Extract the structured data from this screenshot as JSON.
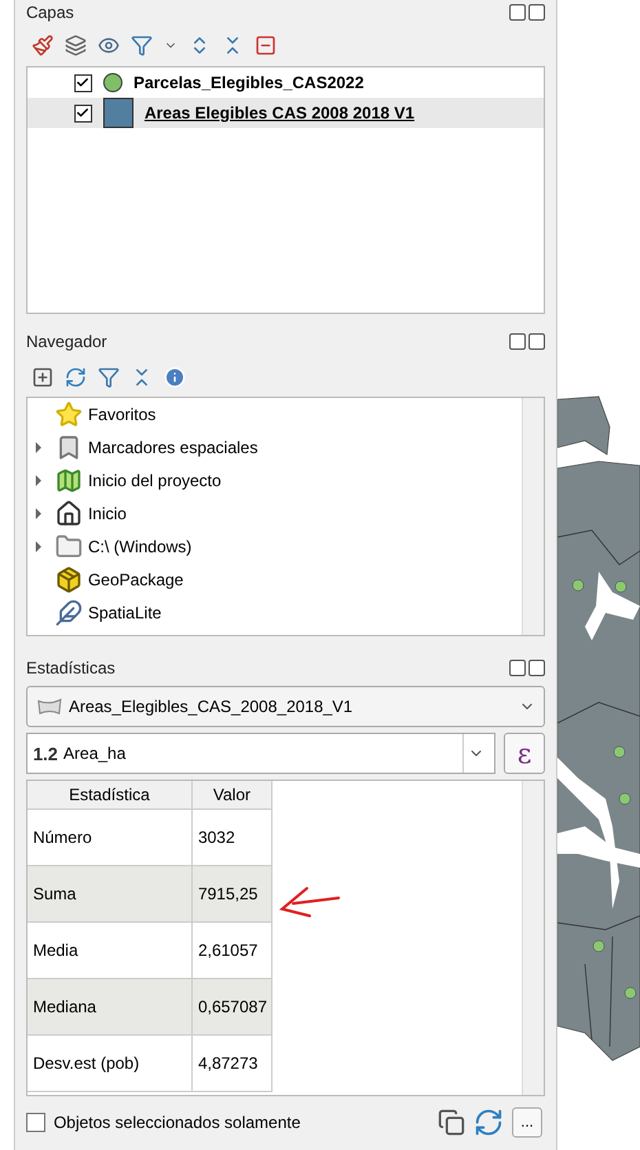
{
  "layers_panel": {
    "title": "Capas",
    "layers": [
      {
        "name": "Parcelas_Elegibles_CAS2022",
        "checked": true,
        "kind": "point",
        "color": "#7fbf67",
        "selected": false
      },
      {
        "name": "Areas Elegibles CAS 2008 2018 V1",
        "checked": true,
        "kind": "polygon",
        "color": "#527ea0",
        "selected": true
      }
    ]
  },
  "browser_panel": {
    "title": "Navegador",
    "items": [
      {
        "label": "Favoritos",
        "kind": "star",
        "expandable": false
      },
      {
        "label": "Marcadores espaciales",
        "kind": "bookmark",
        "expandable": true
      },
      {
        "label": "Inicio del proyecto",
        "kind": "project",
        "expandable": true
      },
      {
        "label": "Inicio",
        "kind": "home",
        "expandable": true
      },
      {
        "label": "C:\\ (Windows)",
        "kind": "folder",
        "expandable": true
      },
      {
        "label": "GeoPackage",
        "kind": "geopackage",
        "expandable": false
      },
      {
        "label": "SpatiaLite",
        "kind": "feather",
        "expandable": false
      }
    ]
  },
  "stats_panel": {
    "title": "Estadísticas",
    "layer": "Areas_Elegibles_CAS_2008_2018_V1",
    "field_type": "1.2",
    "field": "Area_ha",
    "expression_button": "ε",
    "columns": [
      "Estadística",
      "Valor"
    ],
    "rows": [
      {
        "statistic": "Número",
        "value": "3032"
      },
      {
        "statistic": "Suma",
        "value": "7915,25"
      },
      {
        "statistic": "Media",
        "value": "2,61057"
      },
      {
        "statistic": "Mediana",
        "value": "0,657087"
      },
      {
        "statistic": "Desv.est (pob)",
        "value": "4,87273"
      }
    ],
    "selected_only": {
      "label": "Objetos seleccionados solamente",
      "checked": false
    },
    "options_button": "..."
  }
}
